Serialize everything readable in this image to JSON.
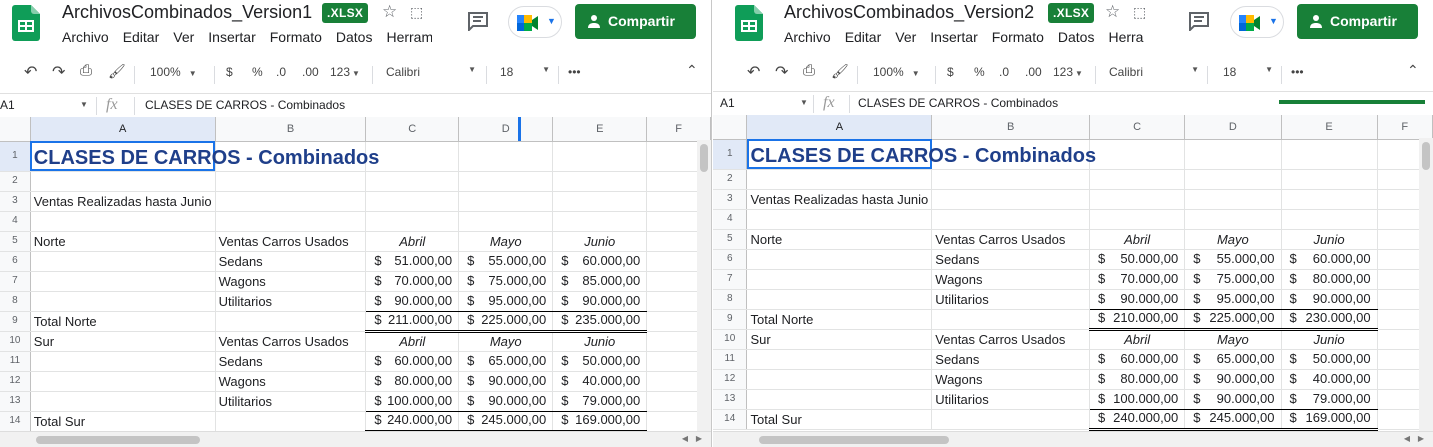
{
  "colors": {
    "brand_green": "#188038",
    "title_blue": "#1f3f8a",
    "select_blue": "#1a73e8"
  },
  "windows": [
    {
      "doc_title": "ArchivosCombinados_Version1",
      "file_badge": ".XLSX",
      "menu": [
        "Archivo",
        "Editar",
        "Ver",
        "Insertar",
        "Formato",
        "Datos",
        "Herram"
      ],
      "share_label": "Compartir",
      "toolbar": {
        "zoom": "100%",
        "currency": "$",
        "percent": "%",
        "dec_less": ".0",
        "dec_more": ".00",
        "format": "123",
        "font": "Calibri",
        "size": "18",
        "more": "•••"
      },
      "formula": {
        "cell_ref": "A1",
        "fx": "fx",
        "value": "CLASES DE CARROS - Combinados"
      },
      "columns": [
        "A",
        "B",
        "C",
        "D",
        "E",
        "F"
      ],
      "rows": {
        "r1": {
          "num": "1",
          "title": "CLASES DE CARROS - Combinados"
        },
        "r2": {
          "num": "2"
        },
        "r3": {
          "num": "3",
          "a": "Ventas Realizadas hasta Junio"
        },
        "r4": {
          "num": "4"
        },
        "r5": {
          "num": "5",
          "a": "Norte",
          "b": "Ventas Carros Usados",
          "c": "Abril",
          "d": "Mayo",
          "e": "Junio"
        },
        "r6": {
          "num": "6",
          "b": "Sedans",
          "c": "51.000,00",
          "d": "55.000,00",
          "e": "60.000,00"
        },
        "r7": {
          "num": "7",
          "b": "Wagons",
          "c": "70.000,00",
          "d": "75.000,00",
          "e": "85.000,00"
        },
        "r8": {
          "num": "8",
          "b": "Utilitarios",
          "c": "90.000,00",
          "d": "95.000,00",
          "e": "90.000,00"
        },
        "r9": {
          "num": "9",
          "a": "Total Norte",
          "c": "211.000,00",
          "d": "225.000,00",
          "e": "235.000,00"
        },
        "r10": {
          "num": "10",
          "a": "Sur",
          "b": "Ventas Carros Usados",
          "c": "Abril",
          "d": "Mayo",
          "e": "Junio"
        },
        "r11": {
          "num": "11",
          "b": "Sedans",
          "c": "60.000,00",
          "d": "65.000,00",
          "e": "50.000,00"
        },
        "r12": {
          "num": "12",
          "b": "Wagons",
          "c": "80.000,00",
          "d": "90.000,00",
          "e": "40.000,00"
        },
        "r13": {
          "num": "13",
          "b": "Utilitarios",
          "c": "100.000,00",
          "d": "90.000,00",
          "e": "79.000,00"
        },
        "r14": {
          "num": "14",
          "a": "Total Sur",
          "c": "240.000,00",
          "d": "245.000,00",
          "e": "169.000,00"
        }
      },
      "currency_symbol": "$"
    },
    {
      "doc_title": "ArchivosCombinados_Version2",
      "file_badge": ".XLSX",
      "menu": [
        "Archivo",
        "Editar",
        "Ver",
        "Insertar",
        "Formato",
        "Datos",
        "Herra"
      ],
      "share_label": "Compartir",
      "toolbar": {
        "zoom": "100%",
        "currency": "$",
        "percent": "%",
        "dec_less": ".0",
        "dec_more": ".00",
        "format": "123",
        "font": "Calibri",
        "size": "18",
        "more": "•••"
      },
      "formula": {
        "cell_ref": "A1",
        "fx": "fx",
        "value": "CLASES DE CARROS - Combinados"
      },
      "columns": [
        "A",
        "B",
        "C",
        "D",
        "E",
        "F"
      ],
      "rows": {
        "r1": {
          "num": "1",
          "title": "CLASES DE CARROS - Combinados"
        },
        "r2": {
          "num": "2"
        },
        "r3": {
          "num": "3",
          "a": "Ventas Realizadas hasta Junio"
        },
        "r4": {
          "num": "4"
        },
        "r5": {
          "num": "5",
          "a": "Norte",
          "b": "Ventas Carros Usados",
          "c": "Abril",
          "d": "Mayo",
          "e": "Junio"
        },
        "r6": {
          "num": "6",
          "b": "Sedans",
          "c": "50.000,00",
          "d": "55.000,00",
          "e": "60.000,00"
        },
        "r7": {
          "num": "7",
          "b": "Wagons",
          "c": "70.000,00",
          "d": "75.000,00",
          "e": "80.000,00"
        },
        "r8": {
          "num": "8",
          "b": "Utilitarios",
          "c": "90.000,00",
          "d": "95.000,00",
          "e": "90.000,00"
        },
        "r9": {
          "num": "9",
          "a": "Total Norte",
          "c": "210.000,00",
          "d": "225.000,00",
          "e": "230.000,00"
        },
        "r10": {
          "num": "10",
          "a": "Sur",
          "b": "Ventas Carros Usados",
          "c": "Abril",
          "d": "Mayo",
          "e": "Junio"
        },
        "r11": {
          "num": "11",
          "b": "Sedans",
          "c": "60.000,00",
          "d": "65.000,00",
          "e": "50.000,00"
        },
        "r12": {
          "num": "12",
          "b": "Wagons",
          "c": "80.000,00",
          "d": "90.000,00",
          "e": "40.000,00"
        },
        "r13": {
          "num": "13",
          "b": "Utilitarios",
          "c": "100.000,00",
          "d": "90.000,00",
          "e": "79.000,00"
        },
        "r14": {
          "num": "14",
          "a": "Total Sur",
          "c": "240.000,00",
          "d": "245.000,00",
          "e": "169.000,00"
        }
      },
      "currency_symbol": "$"
    }
  ]
}
